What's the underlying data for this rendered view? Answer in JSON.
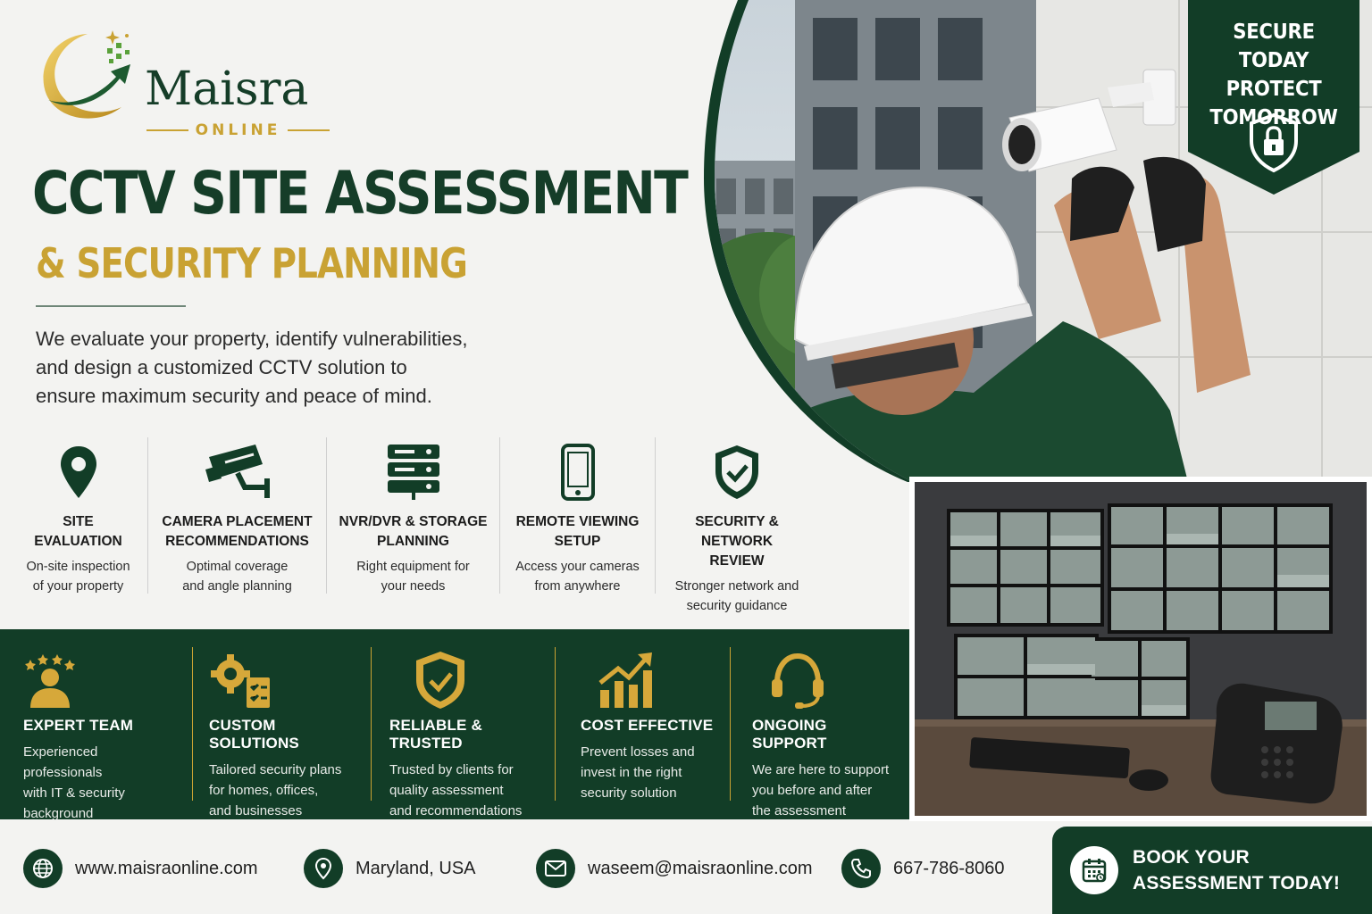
{
  "brand": {
    "name": "Maisra",
    "tagline": "ONLINE"
  },
  "headline": {
    "title": "CCTV SITE ASSESSMENT",
    "subtitle": "& SECURITY PLANNING",
    "intro_lines": [
      "We evaluate your property, identify vulnerabilities,",
      "and design a customized CCTV solution to",
      "ensure maximum security and peace of mind."
    ]
  },
  "badge": {
    "lines": [
      "SECURE TODAY",
      "PROTECT",
      "TOMORROW"
    ],
    "icon": "shield-lock-icon"
  },
  "features": [
    {
      "icon": "location-pin-icon",
      "title_lines": [
        "SITE",
        "EVALUATION"
      ],
      "desc_lines": [
        "On-site inspection",
        "of your property"
      ]
    },
    {
      "icon": "cctv-camera-icon",
      "title_lines": [
        "CAMERA PLACEMENT",
        "RECOMMENDATIONS"
      ],
      "desc_lines": [
        "Optimal coverage",
        "and angle planning"
      ]
    },
    {
      "icon": "server-storage-icon",
      "title_lines": [
        "NVR/DVR & STORAGE",
        "PLANNING"
      ],
      "desc_lines": [
        "Right equipment for",
        "your needs"
      ]
    },
    {
      "icon": "smartphone-icon",
      "title_lines": [
        "REMOTE VIEWING",
        "SETUP"
      ],
      "desc_lines": [
        "Access your cameras",
        "from anywhere"
      ]
    },
    {
      "icon": "shield-check-icon",
      "title_lines": [
        "SECURITY & NETWORK",
        "REVIEW"
      ],
      "desc_lines": [
        "Stronger network and",
        "security guidance"
      ]
    }
  ],
  "benefits": [
    {
      "icon": "expert-person-stars-icon",
      "title": "EXPERT TEAM",
      "desc_lines": [
        "Experienced professionals",
        "with IT & security",
        "background"
      ]
    },
    {
      "icon": "gears-checklist-icon",
      "title": "CUSTOM SOLUTIONS",
      "desc_lines": [
        "Tailored security plans",
        "for homes, offices,",
        "and businesses"
      ]
    },
    {
      "icon": "shield-check-icon",
      "title": "RELIABLE & TRUSTED",
      "desc_lines": [
        "Trusted by clients for",
        "quality assessment",
        "and recommendations"
      ]
    },
    {
      "icon": "growth-chart-icon",
      "title": "COST EFFECTIVE",
      "desc_lines": [
        "Prevent losses and",
        "invest in the right",
        "security solution"
      ]
    },
    {
      "icon": "headset-icon",
      "title": "ONGOING SUPPORT",
      "desc_lines": [
        "We are here to support",
        "you before and after",
        "the assessment"
      ]
    }
  ],
  "contacts": {
    "website": "www.maisraonline.com",
    "location": "Maryland, USA",
    "email": "waseem@maisraonline.com",
    "phone": "667-786-8060"
  },
  "cta": {
    "lines": [
      "BOOK YOUR",
      "ASSESSMENT TODAY!"
    ],
    "icon": "calendar-icon"
  },
  "colors": {
    "brand_green": "#123d27",
    "brand_gold": "#c9a233",
    "background": "#f3f3f1"
  }
}
